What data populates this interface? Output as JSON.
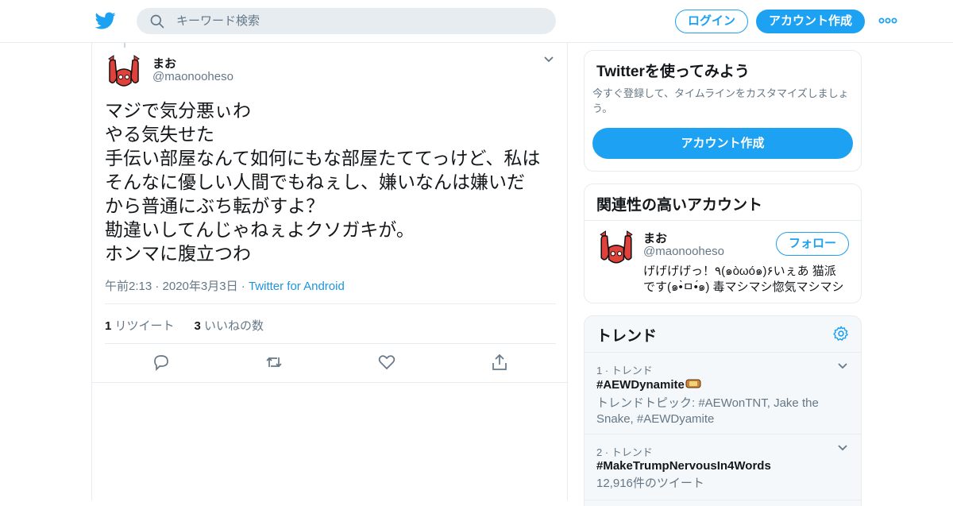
{
  "header": {
    "search_placeholder": "キーワード検索",
    "login_label": "ログイン",
    "signup_label": "アカウント作成"
  },
  "tweet": {
    "name": "まお",
    "handle": "@maonooheso",
    "lines": [
      "マジで気分悪ぃわ",
      "やる気失せた",
      "手伝い部屋なんて如何にもな部屋たててっけど、私は",
      "そんなに優しい人間でもねぇし、嫌いなんは嫌いだ",
      "から普通にぶち転がすよ？",
      "勘違いしてんじゃねぇよクソガキが。",
      "ホンマに腹立つわ"
    ],
    "timestamp": "午前2:13 · 2020年3月3日",
    "dot": " · ",
    "source": "Twitter for Android",
    "retweets_count": "1",
    "retweets_label": " リツイート",
    "likes_count": "3",
    "likes_label": " いいねの数"
  },
  "signup_card": {
    "title": "Twitterを使ってみよう",
    "description": "今すぐ登録して、タイムラインをカスタマイズしましょう。",
    "button_label": "アカウント作成"
  },
  "related_card": {
    "title": "関連性の高いアカウント",
    "name": "まお",
    "handle": "@maonooheso",
    "follow_label": "フォロー",
    "bio_lines": [
      "げげげげっ！٩(๑òωó๑)۶いぇあ 猫派",
      "です(๑•̀ㅁ•́๑) 毒マシマシ惚気マシマシ"
    ]
  },
  "trends": {
    "title": "トレンド",
    "items": [
      {
        "rank": "1 · トレンド",
        "name": "#AEWDynamite",
        "sub": "トレンドトピック: #AEWonTNT, Jake the Snake, #AEWDyamite"
      },
      {
        "rank": "2 · トレンド",
        "name": "#MakeTrumpNervousIn4Words",
        "sub": "12,916件のツイート"
      }
    ]
  },
  "colors": {
    "brand_blue": "#1da1f2",
    "link_blue": "#1b95e0",
    "secondary_text": "#657786",
    "avatar_red": "#e0413a"
  }
}
